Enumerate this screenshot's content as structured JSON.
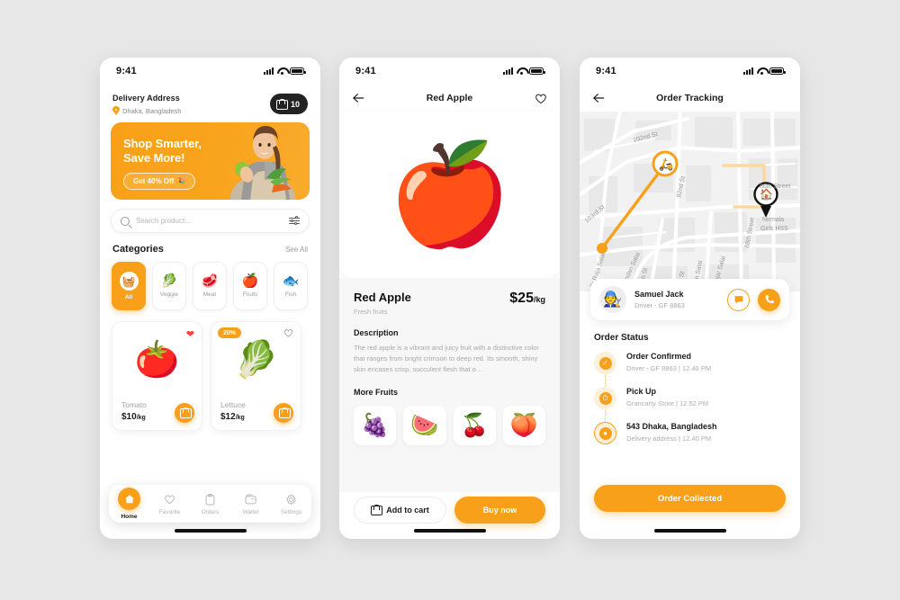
{
  "status_bar": {
    "time": "9:41"
  },
  "home": {
    "address_label": "Delivery Address",
    "address_value": "Dhaka, Bangladesh",
    "cart_count": "10",
    "banner": {
      "title": "Shop Smarter,\nSave More!",
      "button": "Get 40% Off",
      "button_emoji": "🎉",
      "photo_emoji": "👩"
    },
    "search": {
      "placeholder": "Search product..."
    },
    "categories_title": "Categories",
    "see_all": "See All",
    "categories": [
      {
        "label": "All",
        "emoji": "🧺",
        "active": true
      },
      {
        "label": "Veggie",
        "emoji": "🥬",
        "active": false
      },
      {
        "label": "Meat",
        "emoji": "🥩",
        "active": false
      },
      {
        "label": "Fruits",
        "emoji": "🍎",
        "active": false
      },
      {
        "label": "Fish",
        "emoji": "🐟",
        "active": false
      }
    ],
    "products": [
      {
        "name": "Tomato",
        "price": "$10",
        "unit": "/kg",
        "emoji": "🍅",
        "favorite": true,
        "badge": ""
      },
      {
        "name": "Lettuce",
        "price": "$12",
        "unit": "/kg",
        "emoji": "🥬",
        "favorite": false,
        "badge": "20%"
      }
    ],
    "tabs": [
      {
        "label": "Home",
        "icon": "home-icon",
        "active": true
      },
      {
        "label": "Favorite",
        "icon": "heart-icon",
        "active": false
      },
      {
        "label": "Orders",
        "icon": "clipboard-icon",
        "active": false
      },
      {
        "label": "Wallet",
        "icon": "wallet-icon",
        "active": false
      },
      {
        "label": "Settings",
        "icon": "gear-icon",
        "active": false
      }
    ]
  },
  "detail": {
    "nav_title": "Red Apple",
    "hero_emoji": "🍎",
    "name": "Red Apple",
    "subtitle": "Fresh fruits",
    "price": "$25",
    "price_unit": "/kg",
    "description_title": "Description",
    "description": "The red apple is a vibrant and juicy fruit with a distinctive color that ranges from bright crimson to deep red. Its smooth, shiny skin encases crisp, succulent flesh that o…",
    "more_title": "More Fruits",
    "more_fruits": [
      {
        "name": "grapes",
        "emoji": "🍇"
      },
      {
        "name": "watermelon",
        "emoji": "🍉"
      },
      {
        "name": "cherries",
        "emoji": "🍒"
      },
      {
        "name": "peach",
        "emoji": "🍑"
      }
    ],
    "add_to_cart": "Add to cart",
    "buy_now": "Buy now"
  },
  "tracking": {
    "nav_title": "Order Tracking",
    "map": {
      "street_labels": [
        "102nd St",
        "103rd St",
        "92nd St",
        "86th Street",
        "88th Street",
        "Nirmala Girls HSS",
        "87th St",
        "Nandan Salai",
        "Tr Raja Salai",
        "4th St",
        "Jam Salai",
        "Arajar Salai"
      ],
      "courier_icon": "scooter-icon",
      "destination_icon": "home-pin-icon"
    },
    "driver": {
      "name": "Samuel Jack",
      "sub": "Driver - GF 8863",
      "avatar_emoji": "🧑‍🔧",
      "chat_icon": "chat-icon",
      "call_icon": "phone-icon"
    },
    "status_title": "Order Status",
    "steps": [
      {
        "title": "Order Confirmed",
        "sub": "Driver - GF 8863 | 12.40 PM",
        "icon": "check-icon"
      },
      {
        "title": "Pick Up",
        "sub": "Grancarty Store | 12.52 PM",
        "icon": "clock-icon"
      },
      {
        "title": "543 Dhaka, Bangladesh",
        "sub": "Delivery address | 12.40 PM",
        "icon": "pin-icon"
      }
    ],
    "collect_button": "Order Collected"
  }
}
